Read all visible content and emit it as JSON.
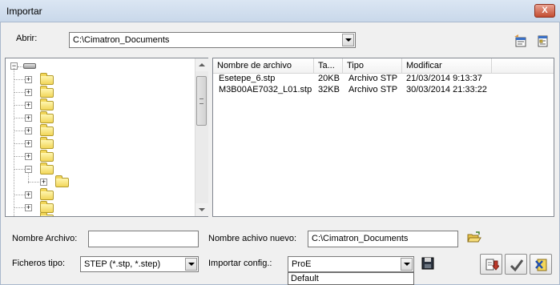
{
  "window": {
    "title": "Importar",
    "close_symbol": "X"
  },
  "open": {
    "label": "Abrir:",
    "path": "C:\\Cimatron_Documents"
  },
  "toolbar_icons": [
    "properties-icon",
    "folder-view-icon"
  ],
  "file_list": {
    "columns": [
      "Nombre de archivo",
      "Ta...",
      "Tipo",
      "Modificar"
    ],
    "rows": [
      [
        "Esetepe_6.stp",
        "20KB",
        "Archivo STP",
        "21/03/2014 9:13:37"
      ],
      [
        "M3B00AE7032_L01.stp",
        "32KB",
        "Archivo STP",
        "30/03/2014 21:33:22"
      ]
    ]
  },
  "form": {
    "file_name_label": "Nombre Archivo:",
    "file_name_value": "",
    "new_file_name_label": "Nombre achivo nuevo:",
    "new_file_name_value": "C:\\Cimatron_Documents",
    "file_types_label": "Ficheros tipo:",
    "file_types_value": "STEP (*.stp, *.step)",
    "import_config_label": "Importar config.:",
    "import_config_value": "ProE",
    "import_config_options_visible": [
      "Default"
    ]
  },
  "colors": {
    "titlebar": "#c9d8ea",
    "close_button": "#c24b30",
    "folder": "#f2d65a",
    "window_bg": "#f0f0f0"
  }
}
